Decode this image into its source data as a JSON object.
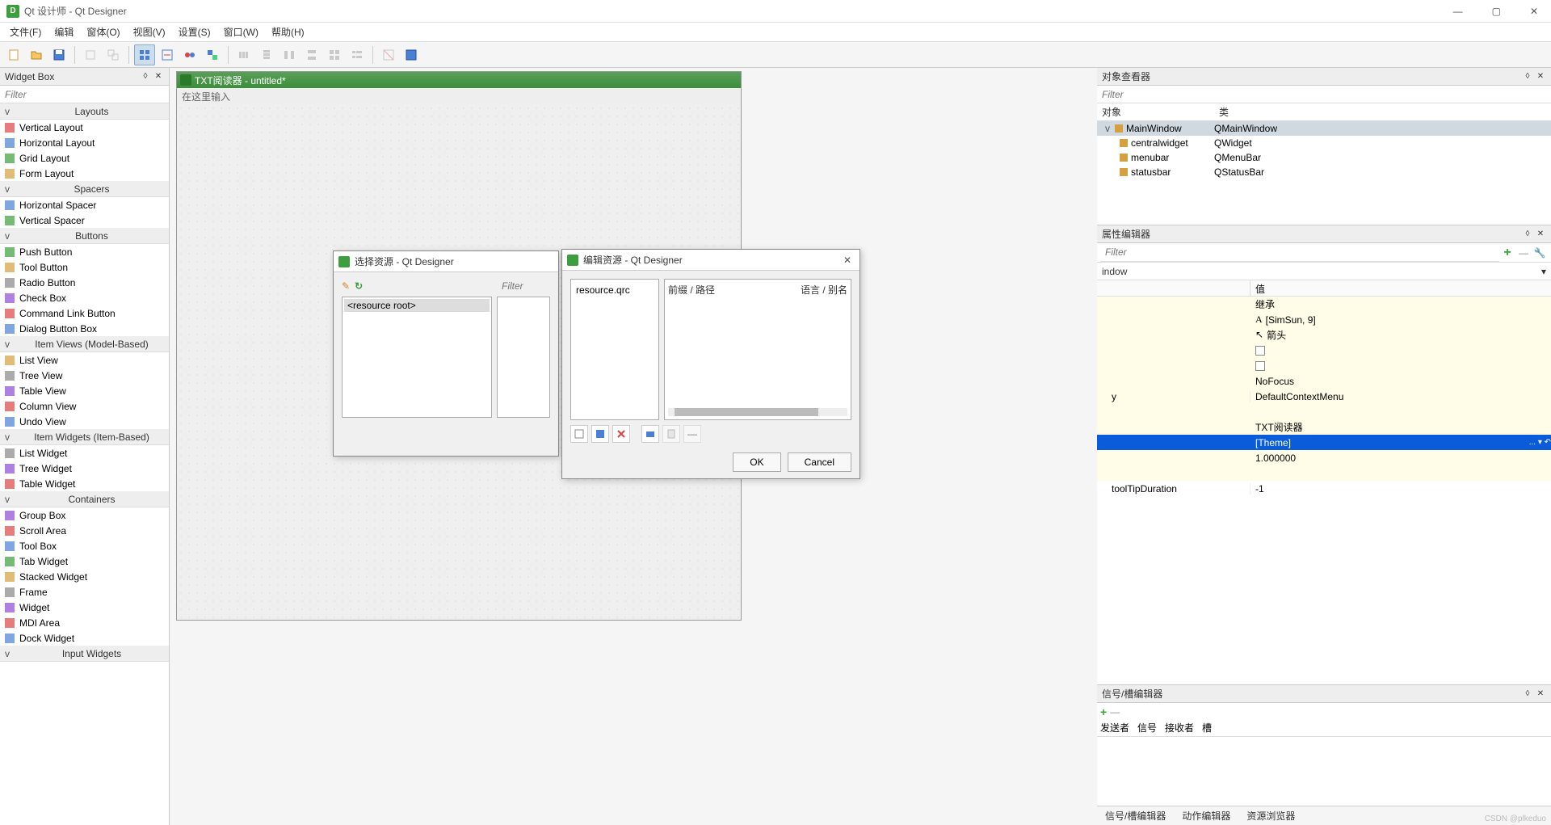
{
  "window": {
    "title": "Qt 设计师 - Qt Designer",
    "controls": {
      "min": "—",
      "max": "▢",
      "close": "✕"
    }
  },
  "menubar": [
    "文件(F)",
    "编辑",
    "窗体(O)",
    "视图(V)",
    "设置(S)",
    "窗口(W)",
    "帮助(H)"
  ],
  "widgetbox": {
    "title": "Widget Box",
    "filter_placeholder": "Filter",
    "categories": [
      {
        "label": "Layouts",
        "items": [
          "Vertical Layout",
          "Horizontal Layout",
          "Grid Layout",
          "Form Layout"
        ]
      },
      {
        "label": "Spacers",
        "items": [
          "Horizontal Spacer",
          "Vertical Spacer"
        ]
      },
      {
        "label": "Buttons",
        "items": [
          "Push Button",
          "Tool Button",
          "Radio Button",
          "Check Box",
          "Command Link Button",
          "Dialog Button Box"
        ]
      },
      {
        "label": "Item Views (Model-Based)",
        "items": [
          "List View",
          "Tree View",
          "Table View",
          "Column View",
          "Undo View"
        ]
      },
      {
        "label": "Item Widgets (Item-Based)",
        "items": [
          "List Widget",
          "Tree Widget",
          "Table Widget"
        ]
      },
      {
        "label": "Containers",
        "items": [
          "Group Box",
          "Scroll Area",
          "Tool Box",
          "Tab Widget",
          "Stacked Widget",
          "Frame",
          "Widget",
          "MDI Area",
          "Dock Widget"
        ]
      },
      {
        "label": "Input Widgets",
        "items": []
      }
    ]
  },
  "canvas": {
    "form_title": "TXT阅读器 - untitled*",
    "form_menubar_hint": "在这里输入"
  },
  "object_inspector": {
    "title": "对象查看器",
    "filter_placeholder": "Filter",
    "columns": [
      "对象",
      "类"
    ],
    "rows": [
      {
        "indent": 0,
        "name": "MainWindow",
        "class": "QMainWindow",
        "selected": true,
        "expand": "v"
      },
      {
        "indent": 1,
        "name": "centralwidget",
        "class": "QWidget"
      },
      {
        "indent": 1,
        "name": "menubar",
        "class": "QMenuBar"
      },
      {
        "indent": 1,
        "name": "statusbar",
        "class": "QStatusBar"
      }
    ]
  },
  "property_editor": {
    "title": "属性编辑器",
    "filter_placeholder": "Filter",
    "combo": "indow",
    "columns": [
      "",
      "值"
    ],
    "rows": [
      {
        "name": "",
        "val": "继承",
        "yellow": true
      },
      {
        "name": "",
        "val": "[SimSun, 9]",
        "yellow": true,
        "icon": "A"
      },
      {
        "name": "",
        "val": "箭头",
        "yellow": true,
        "icon": "↖"
      },
      {
        "name": "",
        "val": "",
        "yellow": true,
        "checkbox": true
      },
      {
        "name": "",
        "val": "",
        "yellow": true,
        "checkbox": true
      },
      {
        "name": "",
        "val": "NoFocus",
        "yellow": true
      },
      {
        "name": "y",
        "val": "DefaultContextMenu",
        "yellow": true
      },
      {
        "name": "",
        "val": "",
        "yellow": true
      },
      {
        "name": "",
        "val": "TXT阅读器",
        "yellow": true
      },
      {
        "name": "",
        "val": "[Theme]",
        "selected": true,
        "extra": "... ▾ ↶"
      },
      {
        "name": "",
        "val": "1.000000",
        "yellow": true
      },
      {
        "name": "",
        "val": "",
        "yellow": true
      },
      {
        "name": "toolTipDuration",
        "val": "-1",
        "yellow": false
      }
    ]
  },
  "signal_editor": {
    "title": "信号/槽编辑器",
    "columns": [
      "发送者",
      "信号",
      "接收者",
      "槽"
    ]
  },
  "bottom_tabs": [
    "信号/槽编辑器",
    "动作编辑器",
    "资源浏览器"
  ],
  "dialog1": {
    "title": "选择资源 - Qt Designer",
    "filter_placeholder": "Filter",
    "tree_root": "<resource root>"
  },
  "dialog2": {
    "title": "编辑资源 - Qt Designer",
    "left_item": "resource.qrc",
    "col1": "前缀 / 路径",
    "col2": "语言 / 别名",
    "ok": "OK",
    "cancel": "Cancel"
  },
  "watermark": "CSDN @plkeduo"
}
